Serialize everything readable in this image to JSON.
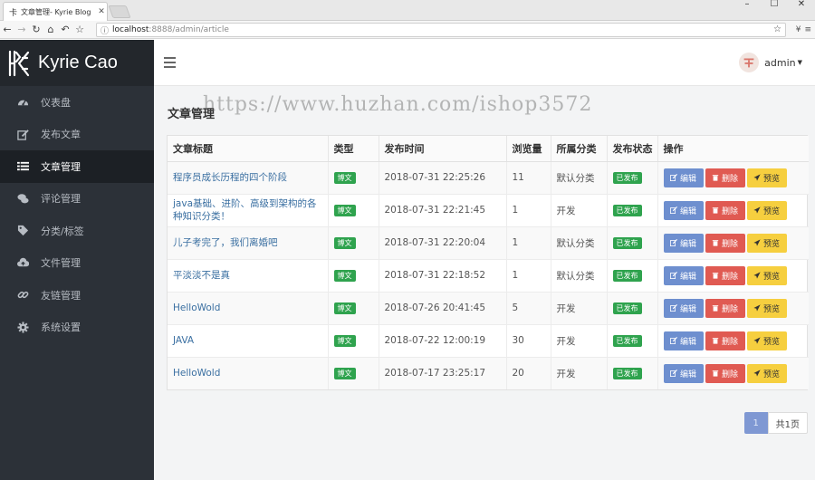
{
  "browser": {
    "tab_title": "文章管理- Kyrie Blog",
    "address_host": "localhost",
    "address_rest": ":8888/admin/article"
  },
  "sidebar": {
    "brand": "Kyrie Cao",
    "items": [
      {
        "label": "仪表盘",
        "icon": "dashboard-icon",
        "active": false
      },
      {
        "label": "发布文章",
        "icon": "edit-icon",
        "active": false
      },
      {
        "label": "文章管理",
        "icon": "list-icon",
        "active": true
      },
      {
        "label": "评论管理",
        "icon": "comments-icon",
        "active": false
      },
      {
        "label": "分类/标签",
        "icon": "tags-icon",
        "active": false
      },
      {
        "label": "文件管理",
        "icon": "cloud-upload-icon",
        "active": false
      },
      {
        "label": "友链管理",
        "icon": "link-icon",
        "active": false
      },
      {
        "label": "系统设置",
        "icon": "gear-icon",
        "active": false
      }
    ]
  },
  "header": {
    "user": "admin"
  },
  "main": {
    "title": "文章管理",
    "watermark": "https://www.huzhan.com/ishop3572",
    "columns": [
      "文章标题",
      "类型",
      "发布时间",
      "浏览量",
      "所属分类",
      "发布状态",
      "操作"
    ],
    "rows": [
      {
        "title": "程序员成长历程的四个阶段",
        "type": "博文",
        "time": "2018-07-31 22:25:26",
        "views": "11",
        "category": "默认分类",
        "status": "已发布"
      },
      {
        "title": "java基础、进阶、高级到架构的各种知识分类！",
        "type": "博文",
        "time": "2018-07-31 22:21:45",
        "views": "1",
        "category": "开发",
        "status": "已发布"
      },
      {
        "title": "儿子考完了，我们离婚吧",
        "type": "博文",
        "time": "2018-07-31 22:20:04",
        "views": "1",
        "category": "默认分类",
        "status": "已发布"
      },
      {
        "title": "平淡淡不是真",
        "type": "博文",
        "time": "2018-07-31 22:18:52",
        "views": "1",
        "category": "默认分类",
        "status": "已发布"
      },
      {
        "title": "HelloWold",
        "type": "博文",
        "time": "2018-07-26 20:41:45",
        "views": "5",
        "category": "开发",
        "status": "已发布"
      },
      {
        "title": "JAVA",
        "type": "博文",
        "time": "2018-07-22 12:00:19",
        "views": "30",
        "category": "开发",
        "status": "已发布"
      },
      {
        "title": "HelloWold",
        "type": "博文",
        "time": "2018-07-17 23:25:17",
        "views": "20",
        "category": "开发",
        "status": "已发布"
      }
    ],
    "actions": {
      "edit": "编辑",
      "delete": "删除",
      "preview": "预览"
    },
    "pager": {
      "current": "1",
      "total": "共1页"
    }
  },
  "colors": {
    "sidebar_bg": "#2c3138",
    "tag_green": "#2fa34e",
    "edit_blue": "#6e8fcf",
    "delete_red": "#e05a52",
    "preview_yellow": "#f6cf3f",
    "link_blue": "#3a6fa1"
  }
}
